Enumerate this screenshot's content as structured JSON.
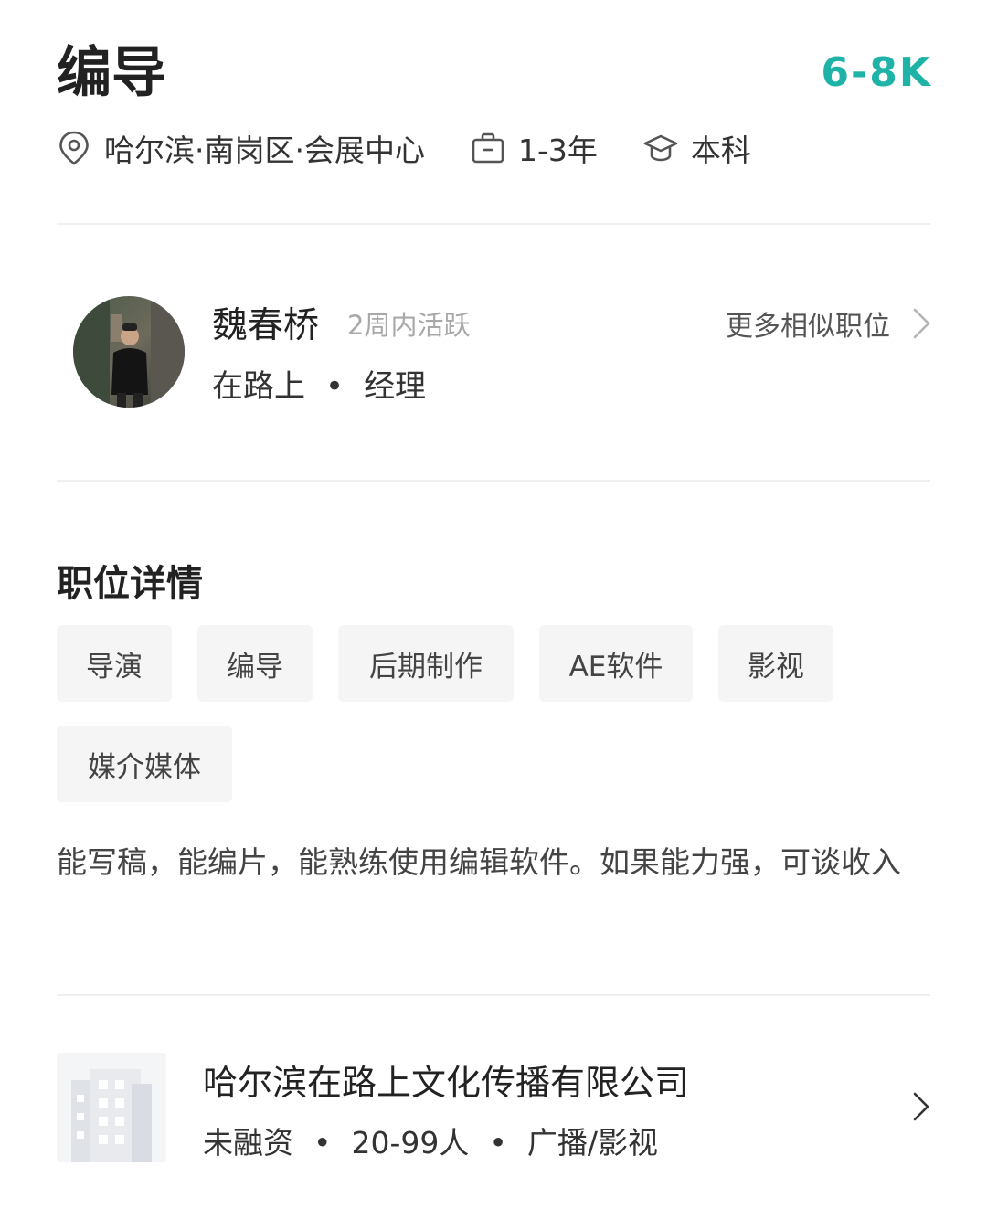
{
  "job": {
    "title": "编导",
    "salary": "6-8K",
    "location": "哈尔滨·南岗区·会展中心",
    "experience": "1-3年",
    "education": "本科"
  },
  "recruiter": {
    "name": "魏春桥",
    "active": "2周内活跃",
    "company_short": "在路上",
    "separator": "•",
    "role": "经理",
    "similar_link": "更多相似职位"
  },
  "details": {
    "section_title": "职位详情",
    "tags": [
      "导演",
      "编导",
      "后期制作",
      "AE软件",
      "影视",
      "媒介媒体"
    ],
    "description": "能写稿，能编片，能熟练使用编辑软件。如果能力强，可谈收入"
  },
  "company": {
    "name": "哈尔滨在路上文化传播有限公司",
    "funding": "未融资",
    "size": "20-99人",
    "industry": "广播/影视",
    "separator": "•"
  },
  "colors": {
    "accent": "#1fb3a8",
    "tag_bg": "#f5f5f5",
    "divider": "#efefef"
  },
  "icons": [
    "location-pin-icon",
    "briefcase-icon",
    "graduation-cap-icon",
    "chevron-right-icon",
    "building-icon"
  ]
}
